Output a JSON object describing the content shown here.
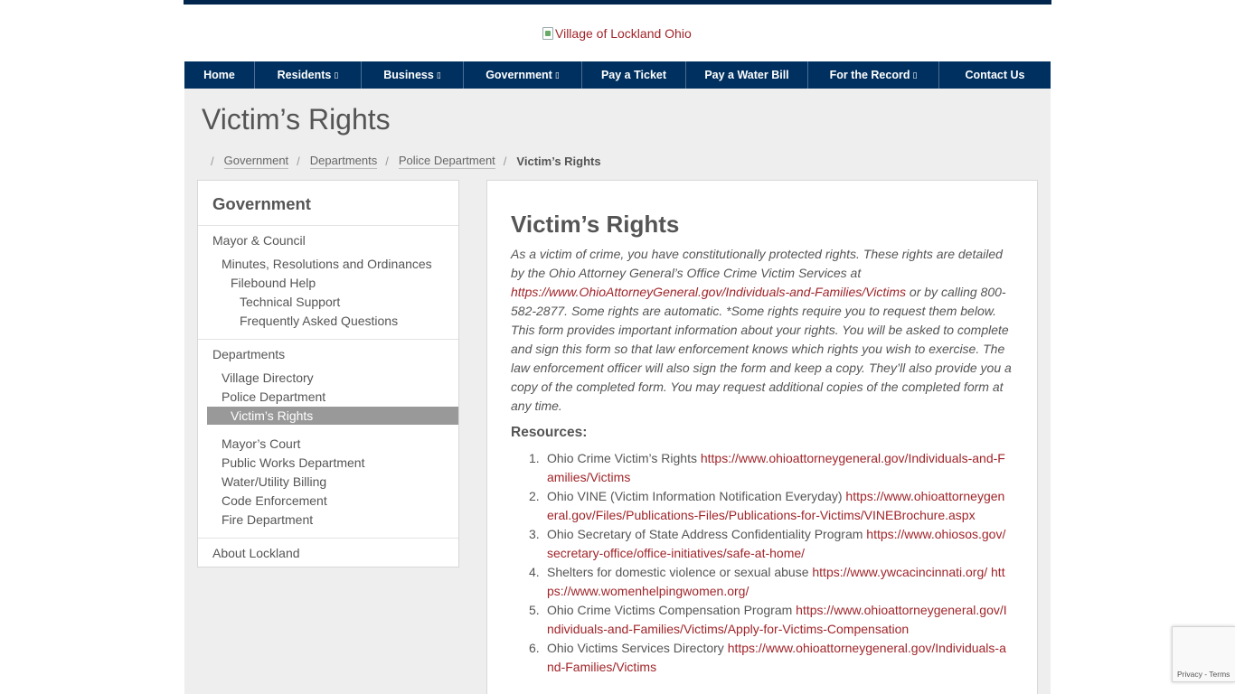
{
  "logo": {
    "alt": "Village of Lockland Ohio"
  },
  "nav": [
    {
      "label": "Home",
      "caret": ""
    },
    {
      "label": "Residents",
      "caret": "▯"
    },
    {
      "label": "Business",
      "caret": "▯"
    },
    {
      "label": "Government",
      "caret": "▯"
    },
    {
      "label": "Pay a Ticket",
      "caret": ""
    },
    {
      "label": "Pay a Water Bill",
      "caret": ""
    },
    {
      "label": "For the Record",
      "caret": "▯"
    },
    {
      "label": "Contact Us",
      "caret": ""
    }
  ],
  "page_title": "Victim’s Rights",
  "breadcrumb": {
    "separator": "/",
    "items": [
      "Government",
      "Departments",
      "Police Department"
    ],
    "current": "Victim’s Rights"
  },
  "sidebar": {
    "heading": "Government",
    "items": [
      "Mayor & Council",
      "Minutes, Resolutions and Ordinances",
      "Filebound Help",
      "Technical Support",
      "Frequently Asked Questions",
      "Departments",
      "Village Directory",
      "Police Department",
      "Victim’s Rights",
      "Mayor’s Court",
      "Public Works Department",
      "Water/Utility Billing",
      "Code Enforcement",
      "Fire Department",
      "About Lockland"
    ]
  },
  "content": {
    "heading": "Victim’s Rights",
    "intro_before": "As a victim of crime, you have constitutionally protected rights. These rights are detailed by the Ohio Attorney General’s Office Crime Victim Services at ",
    "intro_link": "https://www.OhioAttorneyGeneral.gov/Individuals-and-Families/Victims",
    "intro_after": " or by calling 800-582-2877. Some rights are automatic. *Some rights require you to request them below. This form provides important information about your rights. You will be asked to complete and sign this form so that law enforcement knows which rights you wish to exercise. The law enforcement officer will also sign the form and keep a copy. They’ll also provide you a copy of the completed form. You may request additional copies of the completed form at any time.",
    "resources_title": "Resources:",
    "resources": [
      {
        "num": "1.",
        "text": "Ohio Crime Victim’s Rights  ",
        "link1": "https://www.ohioattorneygeneral.gov/Individuals-and-Families/Victims",
        "link2": ""
      },
      {
        "num": "2.",
        "text": "Ohio VINE (Victim Information Notification Everyday)  ",
        "link1": "https://www.ohioattorneygeneral.gov/Files/Publications-Files/Publications-for-Victims/VINEBrochure.aspx",
        "link2": ""
      },
      {
        "num": "3.",
        "text": "Ohio Secretary of State Address Confidentiality Program ",
        "link1": "https://www.ohiosos.gov/secretary-office/office-initiatives/safe-at-home/",
        "link2": ""
      },
      {
        "num": "4.",
        "text": "Shelters for domestic violence or sexual abuse  ",
        "link1": "https://www.ywcacincinnati.org/",
        "link2": "https://www.womenhelpingwomen.org/"
      },
      {
        "num": "5.",
        "text": "Ohio Crime Victims Compensation Program  ",
        "link1": "https://www.ohioattorneygeneral.gov/Individuals-and-Families/Victims/Apply-for-Victims-Compensation",
        "link2": ""
      },
      {
        "num": "6.",
        "text": "Ohio Victims Services Directory  ",
        "link1": "https://www.ohioattorneygeneral.gov/Individuals-and-Families/Victims",
        "link2": ""
      }
    ]
  },
  "recaptcha": {
    "text": "Privacy - Terms"
  },
  "colors": {
    "nav_bg": "#00305f",
    "link": "#a0252a",
    "active_bg": "#999999"
  }
}
